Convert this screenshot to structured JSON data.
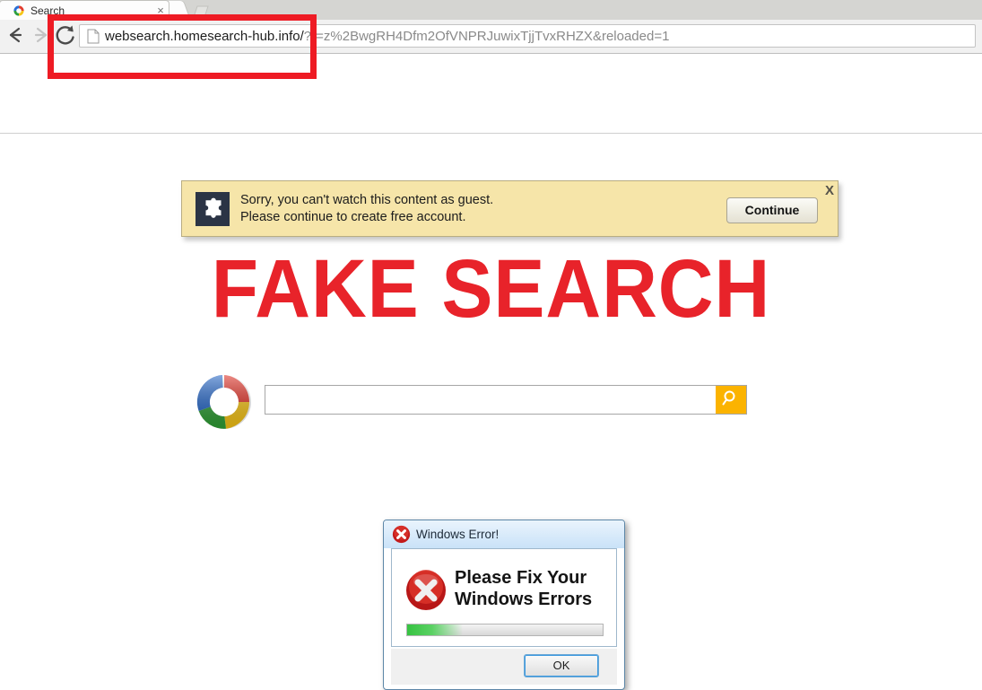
{
  "browser": {
    "tab": {
      "title": "Search",
      "favicon": "multicolor-ring-icon",
      "close_label": "×"
    },
    "nav": {
      "back": "back-arrow-icon",
      "forward": "forward-arrow-icon",
      "reload": "reload-icon"
    },
    "omnibox": {
      "page_icon": "page-document-icon",
      "url_host": "websearch.homesearch-hub.info/",
      "url_rest": "?r=z%2BwgRH4Dfm2OfVNPRJuwixTjjTvxRHZX&reloaded=1",
      "full_url": "websearch.homesearch-hub.info/?r=z%2BwgRH4Dfm2OfVNPRJuwixTjjTvxRHZX&reloaded=1"
    },
    "annotation": {
      "color": "#ee1b24",
      "shape": "rectangle-highlight"
    }
  },
  "banner": {
    "icon": "puzzle-piece-icon",
    "line1": "Sorry, you can't watch this content as guest.",
    "line2": "Please continue to create free account.",
    "continue_label": "Continue",
    "close_label": "X",
    "background_color": "#f6e5a9"
  },
  "page": {
    "headline": "FAKE SEARCH",
    "headline_color": "#e8232a",
    "logo": "multicolor-ring-logo",
    "search": {
      "value": "",
      "placeholder": "",
      "submit_icon": "magnifier-icon",
      "submit_color": "#fbb300"
    }
  },
  "error_dialog": {
    "title": "Windows Error!",
    "title_icon": "red-x-error-icon",
    "body_icon": "red-x-error-icon",
    "message_line1": "Please Fix Your",
    "message_line2": "Windows Errors",
    "progress_percent": 15,
    "progress_color": "#36c341",
    "ok_label": "OK"
  }
}
